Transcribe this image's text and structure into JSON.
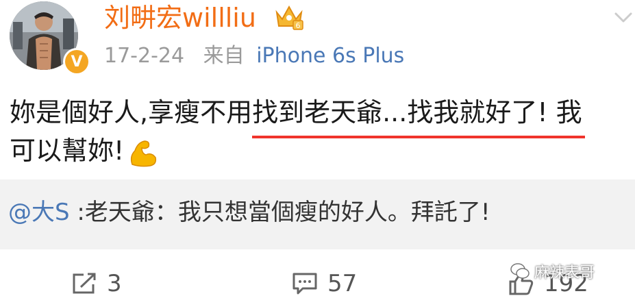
{
  "post": {
    "username": "刘畊宏willliu",
    "date": "17-2-24",
    "source_label": "来自",
    "device": "iPhone 6s Plus",
    "verified_badge": "V",
    "text_line1": "妳是個好人,享瘦不用找到老天爺...找我就好了! 我",
    "text_line2": "可以幫妳!"
  },
  "repost": {
    "mention": "@大S",
    "text": ":老天爺：我只想當個瘦的好人。拜託了!"
  },
  "actions": {
    "share_count": "3",
    "comment_count": "57",
    "like_count": "192"
  },
  "watermark": {
    "text": "麻辣表哥"
  },
  "colors": {
    "username": "#f26d15",
    "link": "#4a78b6",
    "underline": "#f0342c",
    "repost_bg": "#f2f2f2"
  },
  "icons": [
    "avatar",
    "verified-icon",
    "crown-icon",
    "chevron-down-icon",
    "flexed-biceps-emoji",
    "share-icon",
    "comment-icon",
    "like-icon",
    "wechat-icon"
  ]
}
